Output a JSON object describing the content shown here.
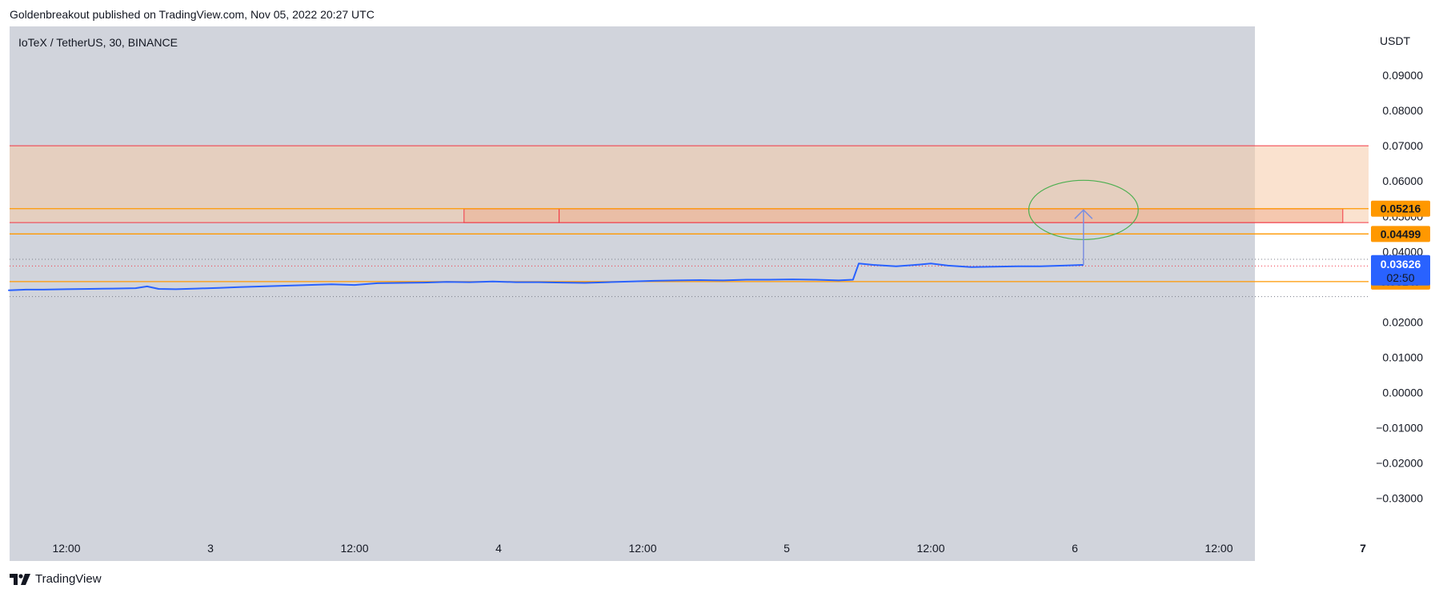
{
  "header": {
    "published": "Goldenbreakout published on TradingView.com, Nov 05, 2022 20:27 UTC"
  },
  "footer": {
    "brand": "TradingView"
  },
  "colors": {
    "plot_bg": "#d1d4dc",
    "line": "#2962ff",
    "zone_fill": "#f5cba7",
    "zone_border": "#f23645",
    "level": "#ff9800",
    "arc": "#4caf50",
    "arrow": "#7b8fe0",
    "price_badge": "#2962ff"
  },
  "chart_data": {
    "type": "line",
    "symbol_title": "IoTeX / TetherUS, 30, BINANCE",
    "currency": "USDT",
    "ylim": [
      -0.035,
      0.1
    ],
    "y_ticks": [
      {
        "value": 0.09,
        "label": "0.09000"
      },
      {
        "value": 0.08,
        "label": "0.08000"
      },
      {
        "value": 0.07,
        "label": "0.07000"
      },
      {
        "value": 0.06,
        "label": "0.06000"
      },
      {
        "value": 0.05,
        "label": "0.05000"
      },
      {
        "value": 0.04,
        "label": "0.04000"
      },
      {
        "value": 0.02,
        "label": "0.02000"
      },
      {
        "value": 0.01,
        "label": "0.01000"
      },
      {
        "value": 0.0,
        "label": "0.00000"
      },
      {
        "value": -0.01,
        "label": "−0.01000"
      },
      {
        "value": -0.02,
        "label": "−0.02000"
      },
      {
        "value": -0.03,
        "label": "−0.03000"
      }
    ],
    "xlim": [
      0,
      5.8
    ],
    "x_ticks": [
      {
        "value": 0.5,
        "label": "12:00"
      },
      {
        "value": 1.0,
        "label": "3"
      },
      {
        "value": 1.5,
        "label": "12:00"
      },
      {
        "value": 2.0,
        "label": "4"
      },
      {
        "value": 2.5,
        "label": "12:00"
      },
      {
        "value": 3.0,
        "label": "5"
      },
      {
        "value": 3.5,
        "label": "12:00"
      },
      {
        "value": 4.0,
        "label": "6"
      },
      {
        "value": 4.5,
        "label": "12:00"
      },
      {
        "value": 5.0,
        "label": "7"
      }
    ],
    "series": [
      {
        "x": [
          0.3,
          0.36,
          0.42,
          0.5,
          0.58,
          0.66,
          0.74,
          0.78,
          0.82,
          0.88,
          0.95,
          1.03,
          1.1,
          1.18,
          1.26,
          1.34,
          1.42,
          1.5,
          1.58,
          1.66,
          1.74,
          1.82,
          1.9,
          1.98,
          2.06,
          2.14,
          2.22,
          2.3,
          2.38,
          2.46,
          2.54,
          2.62,
          2.7,
          2.78,
          2.86,
          2.94,
          3.02,
          3.1,
          3.18,
          3.23,
          3.25,
          3.3,
          3.38,
          3.46,
          3.5,
          3.56,
          3.64,
          3.72,
          3.8,
          3.88,
          3.96,
          4.03
        ],
        "y": [
          0.029,
          0.0292,
          0.0292,
          0.0293,
          0.0294,
          0.0295,
          0.0296,
          0.0301,
          0.0294,
          0.0293,
          0.0295,
          0.0297,
          0.0299,
          0.0301,
          0.0303,
          0.0305,
          0.0307,
          0.0305,
          0.031,
          0.0311,
          0.0312,
          0.0314,
          0.0313,
          0.0315,
          0.0313,
          0.0313,
          0.0312,
          0.0311,
          0.0313,
          0.0315,
          0.0317,
          0.0318,
          0.0319,
          0.0318,
          0.032,
          0.032,
          0.0321,
          0.032,
          0.0318,
          0.032,
          0.0366,
          0.0362,
          0.0358,
          0.0363,
          0.0366,
          0.036,
          0.0356,
          0.0357,
          0.0358,
          0.0358,
          0.036,
          0.0362
        ]
      }
    ],
    "zone": {
      "y0": 0.0482,
      "y1": 0.07
    },
    "sub_boxes": [
      {
        "x0": 1.88,
        "x1": 2.21,
        "y0": 0.0482,
        "y1": 0.0521
      },
      {
        "x0": 2.21,
        "x1": 4.93,
        "y0": 0.0482,
        "y1": 0.0521
      }
    ],
    "levels": [
      {
        "value": 0.05216,
        "label": "0.05216"
      },
      {
        "value": 0.04499,
        "label": "0.04499"
      },
      {
        "value": 0.03147,
        "label": "0.03147"
      }
    ],
    "dotted_levels": [
      0.0378,
      0.0359,
      0.0272
    ],
    "current_price": {
      "value": 0.03626,
      "label": "0.03626",
      "countdown": "02:50"
    },
    "arc": {
      "cx": 4.03,
      "cy": 0.0518,
      "rx": 0.19,
      "ry": 0.0084
    },
    "arrow": {
      "x": 4.03,
      "y_from": 0.0362,
      "y_to": 0.0518
    }
  }
}
